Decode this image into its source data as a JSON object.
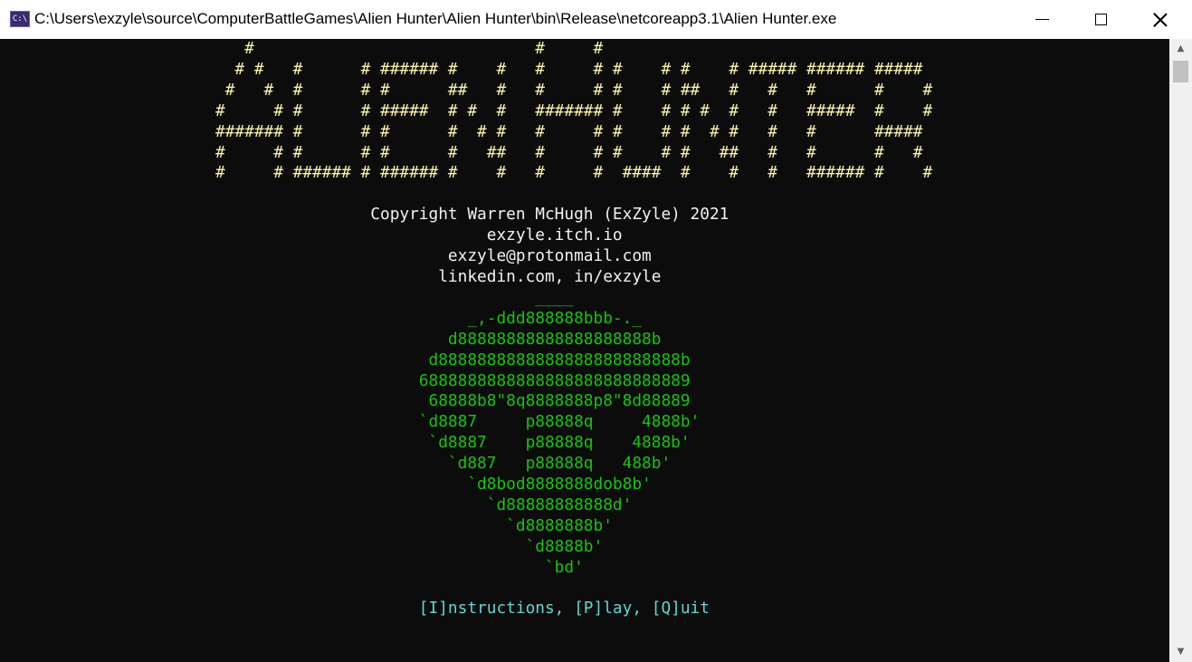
{
  "window": {
    "title": "C:\\Users\\exzyle\\source\\ComputerBattleGames\\Alien Hunter\\Alien Hunter\\bin\\Release\\netcoreapp3.1\\Alien Hunter.exe",
    "icon": "console-app-icon",
    "controls": {
      "minimize": "minimize-icon",
      "maximize": "maximize-icon",
      "close": "close-icon"
    }
  },
  "console": {
    "colors": {
      "background": "#0c0c0c",
      "logo": "#f9f1a5",
      "info": "#f2f2f2",
      "ship": "#16c60c",
      "menu": "#61d6d6"
    },
    "logo_lines": [
      "   #                             #     #",
      "  # #   #      # ###### #    #   #     # #    # #    # ##### ###### #####",
      " #   #  #      # #      ##   #   #     # #    # ##   #   #   #      #    #",
      "#     # #      # #####  # #  #   ####### #    # # #  #   #   #####  #    #",
      "####### #      # #      #  # #   #     # #    # #  # #   #   #      #####",
      "#     # #      # #      #   ##   #     # #    # #   ##   #   #      #   #",
      "#     # ###### # ###### #    #   #     #  ####  #    #   #   ###### #    #"
    ],
    "info_lines": [
      "",
      "                Copyright Warren McHugh (ExZyle) 2021",
      "                            exzyle.itch.io",
      "                        exzyle@protonmail.com",
      "                       linkedin.com, in/exzyle"
    ],
    "ship_lines": [
      "                                 ____",
      "                          _,-ddd888888bbb-._",
      "                        d88888888888888888888b",
      "                      d8888888888888888888888888b",
      "                     6888888888888888888888888889",
      "                      68888b8\"8q8888888p8\"8d88889",
      "                     `d8887     p88888q     4888b'",
      "                      `d8887    p88888q    4888b'",
      "                        `d887   p88888q   488b'",
      "                          `d8bod8888888dob8b'",
      "                            `d88888888888d'",
      "                              `d8888888b'",
      "                                `d8888b'",
      "                                  `bd'",
      ""
    ],
    "menu_line": "                     [I]nstructions, [P]lay, [Q]uit"
  },
  "scrollbar": {
    "up": "▲",
    "down": "▼"
  }
}
